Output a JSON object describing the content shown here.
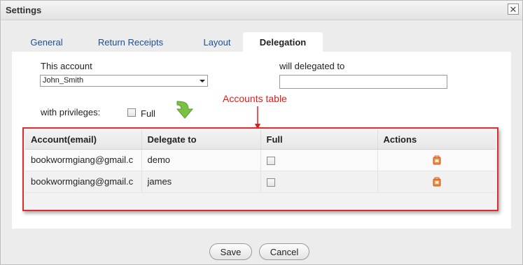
{
  "window": {
    "title": "Settings",
    "close_icon": "close-icon"
  },
  "tabs": [
    {
      "label": "General",
      "active": false
    },
    {
      "label": "Return Receipts",
      "active": false
    },
    {
      "label": "Layout",
      "active": false
    },
    {
      "label": "Delegation",
      "active": true
    }
  ],
  "form": {
    "this_account_label": "This account",
    "account_select_value": "John_Smith",
    "delegated_to_label": "will delegated to",
    "delegated_to_value": "",
    "privileges_label": "with privileges:",
    "full_checkbox_label": "Full",
    "full_checked": false
  },
  "annotation": {
    "text": "Accounts table",
    "color": "#e31b1b"
  },
  "table": {
    "headers": [
      "Account(email)",
      "Delegate to",
      "Full",
      "Actions"
    ],
    "rows": [
      {
        "email": "bookwormgiang@gmail.c",
        "delegate": "demo",
        "full": false,
        "action_icon": "trash-icon"
      },
      {
        "email": "bookwormgiang@gmail.c",
        "delegate": "james",
        "full": false,
        "action_icon": "trash-icon"
      }
    ]
  },
  "buttons": {
    "save": "Save",
    "cancel": "Cancel"
  },
  "colors": {
    "accent_link": "#1c4f92",
    "table_border": "#d8302f",
    "arrow_green": "#7cc242"
  }
}
